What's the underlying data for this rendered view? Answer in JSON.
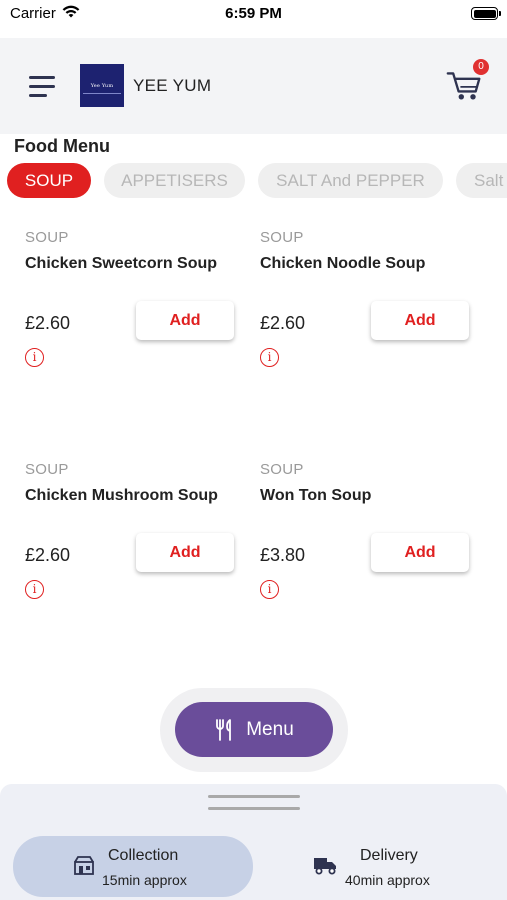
{
  "status_bar": {
    "carrier": "Carrier",
    "time": "6:59 PM"
  },
  "header": {
    "brand_name": "YEE YUM",
    "logo_text": "Yee Yum",
    "cart_count": "0"
  },
  "section_title": "Food Menu",
  "categories": [
    {
      "label": "SOUP",
      "active": true
    },
    {
      "label": "APPETISERS",
      "active": false
    },
    {
      "label": "SALT And PEPPER",
      "active": false
    },
    {
      "label": "Salt",
      "active": false
    }
  ],
  "items": [
    {
      "category": "SOUP",
      "name": "Chicken Sweetcorn Soup",
      "price": "£2.60",
      "add_label": "Add",
      "info_icon": "i"
    },
    {
      "category": "SOUP",
      "name": "Chicken Noodle Soup",
      "price": "£2.60",
      "add_label": "Add",
      "info_icon": "i"
    },
    {
      "category": "SOUP",
      "name": "Chicken Mushroom Soup",
      "price": "£2.60",
      "add_label": "Add",
      "info_icon": "i"
    },
    {
      "category": "SOUP",
      "name": "Won Ton Soup",
      "price": "£3.80",
      "add_label": "Add",
      "info_icon": "i"
    }
  ],
  "menu_button": {
    "label": "Menu",
    "icon": "fork-knife-icon"
  },
  "order_options": {
    "collection": {
      "title": "Collection",
      "subtitle": "15min approx",
      "icon": "store-icon",
      "selected": true
    },
    "delivery": {
      "title": "Delivery",
      "subtitle": "40min approx",
      "icon": "delivery-truck-icon",
      "selected": false
    }
  },
  "colors": {
    "accent_red": "#e02020",
    "menu_purple": "#6a4d9a",
    "selected_option": "#c7d1e6"
  }
}
